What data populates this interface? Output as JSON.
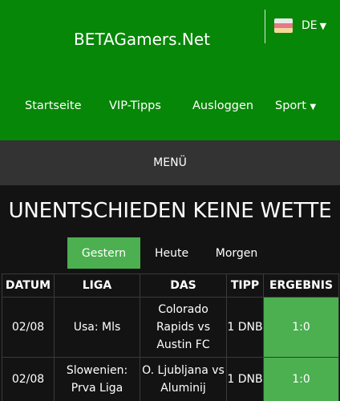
{
  "header": {
    "logo": "BETAGamers.Net",
    "language": {
      "code": "DE",
      "flag_colors": [
        "#e9e9e9",
        "#e47a84",
        "#f3d89c"
      ]
    },
    "nav": [
      {
        "label": "Startseite"
      },
      {
        "label": "VIP-Tipps"
      },
      {
        "label": "Ausloggen"
      },
      {
        "label": "Sport",
        "has_dropdown": true
      }
    ]
  },
  "menu": {
    "label": "MENÜ"
  },
  "page": {
    "title": "UNENTSCHIEDEN KEINE WETTE"
  },
  "tabs": [
    {
      "label": "Gestern",
      "active": true
    },
    {
      "label": "Heute",
      "active": false
    },
    {
      "label": "Morgen",
      "active": false
    }
  ],
  "table": {
    "headers": [
      "DATUM",
      "LIGA",
      "DAS",
      "TIPP",
      "ERGEBNIS"
    ],
    "rows": [
      {
        "date": "02/08",
        "league": "Usa: Mls",
        "match": "Colorado Rapids vs Austin FC",
        "tip": "1 DNB",
        "result": "1:0"
      },
      {
        "date": "02/08",
        "league": "Slowenien: Prva Liga",
        "match": "O. Ljubljana vs Aluminij",
        "tip": "1 DNB",
        "result": "1:0"
      }
    ]
  },
  "colors": {
    "header_green": "#078707",
    "accent_green": "#4caf50",
    "menu_bar": "#333333",
    "background": "#131313"
  }
}
